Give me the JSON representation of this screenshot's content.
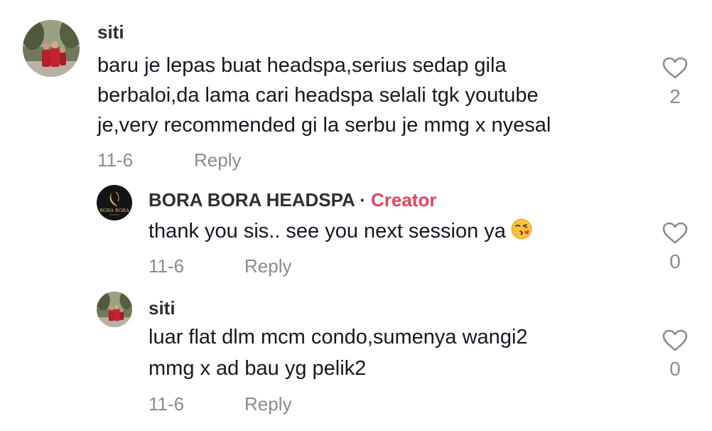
{
  "comments": [
    {
      "username": "siti",
      "lines": [
        "baru je lepas buat headspa,serius sedap gila",
        "berbaloi,da lama cari headspa selali tgk youtube",
        "je,very recommended gi la serbu je mmg x nyesal"
      ],
      "date": "11-6",
      "reply_label": "Reply",
      "likes": "2",
      "avatar": "family-photo-avatar"
    },
    {
      "username": "BORA BORA HEADSPA",
      "separator": "·",
      "badge": "Creator",
      "lines": [
        "thank you sis.. see you next session ya"
      ],
      "emoji": "kissing-face-emoji",
      "date": "11-6",
      "reply_label": "Reply",
      "likes": "0",
      "avatar": "bora-bora-logo-avatar",
      "avatar_logo_text": "BORA BORA"
    },
    {
      "username": "siti",
      "lines": [
        "luar flat dlm mcm condo,sumenya wangi2",
        "mmg x ad bau yg pelik2"
      ],
      "date": "11-6",
      "reply_label": "Reply",
      "likes": "0",
      "avatar": "family-photo-avatar"
    }
  ],
  "colors": {
    "creator_badge": "#e0455f",
    "meta_gray": "#8a8b91",
    "text": "#161823"
  }
}
